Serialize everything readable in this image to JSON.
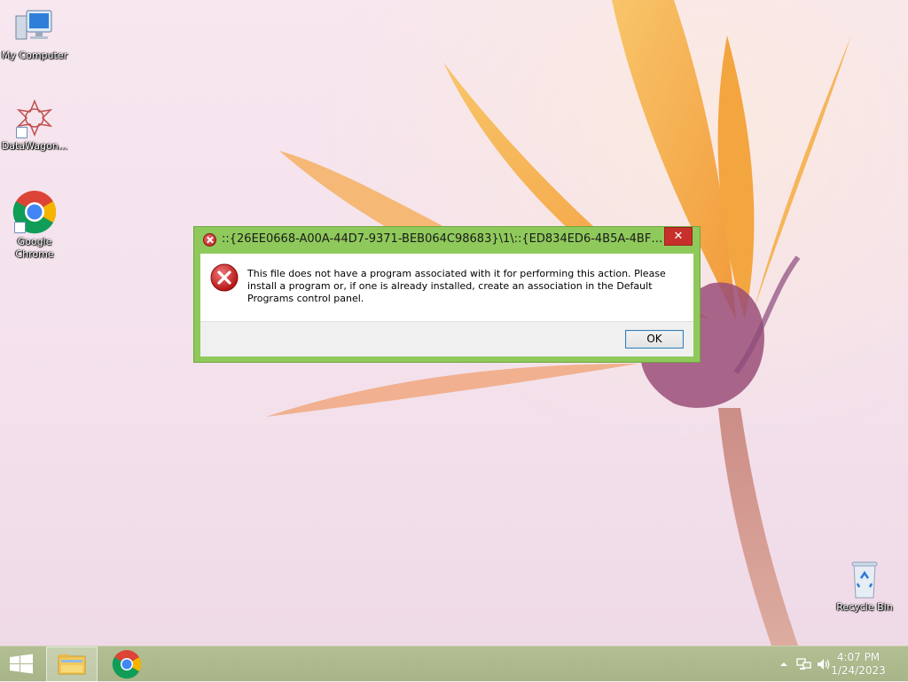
{
  "desktop": {
    "icons": [
      {
        "label": "My Computer",
        "icon": "computer-icon"
      },
      {
        "label": "DataWagon...",
        "icon": "datawagon-icon"
      },
      {
        "label": "Google Chrome",
        "icon": "chrome-icon"
      },
      {
        "label": "Recycle Bin",
        "icon": "recycle-bin-icon"
      }
    ]
  },
  "dialog": {
    "title": "::{26EE0668-A00A-44D7-9371-BEB064C98683}\\1\\::{ED834ED6-4B5A-4BFE-...",
    "close_label": "✕",
    "message": "This file does not have a program associated with it for performing this action. Please install a program or, if one is already installed, create an association in the Default Programs control panel.",
    "ok_label": "OK",
    "icon": "error-icon",
    "accent": "#8fc95b"
  },
  "taskbar": {
    "pinned": [
      "windows-logo-icon",
      "file-explorer-icon",
      "chrome-icon"
    ],
    "tray_icons": [
      "show-hidden-icons-chevron",
      "network-icon",
      "volume-icon"
    ],
    "time": "4:07 PM",
    "date": "1/24/2023",
    "color": "#aebb8f"
  }
}
